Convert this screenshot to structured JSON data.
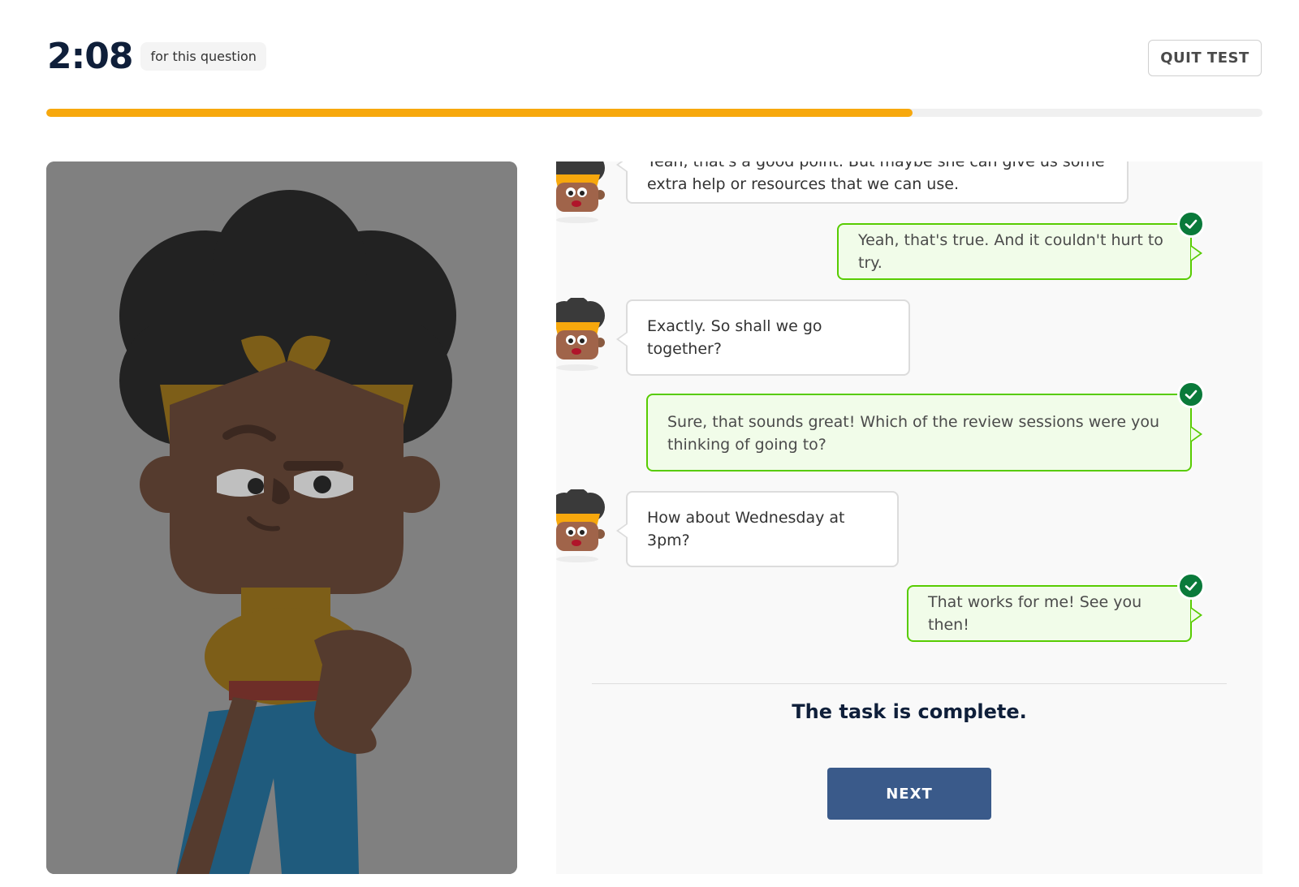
{
  "timer": {
    "value": "2:08",
    "caption": "for this question"
  },
  "header": {
    "quit_label": "QUIT TEST"
  },
  "progress": {
    "fraction": 0.712,
    "color": "#f7a80d"
  },
  "chat": {
    "messages": [
      {
        "role": "partner",
        "text_line1": "Yeah, that's a good point. But maybe she can give us some",
        "text_line2": "extra help or resources that we can use."
      },
      {
        "role": "user",
        "text": "Yeah, that's true. And it couldn't hurt to try."
      },
      {
        "role": "partner",
        "text": "Exactly. So shall we go together?"
      },
      {
        "role": "user",
        "text_line1": "Sure, that sounds great! Which of the review sessions were you",
        "text_line2": "thinking of going to?"
      },
      {
        "role": "partner",
        "text": "How about Wednesday at 3pm?"
      },
      {
        "role": "user",
        "text": "That works for me! See you then!"
      }
    ],
    "complete_text": "The task is complete.",
    "next_label": "NEXT"
  },
  "colors": {
    "accent_orange": "#f7a80d",
    "user_bubble_border": "#58cc02",
    "user_bubble_bg": "#f1fce9",
    "check_green": "#0a7a3a",
    "next_button": "#3a5a8a"
  }
}
